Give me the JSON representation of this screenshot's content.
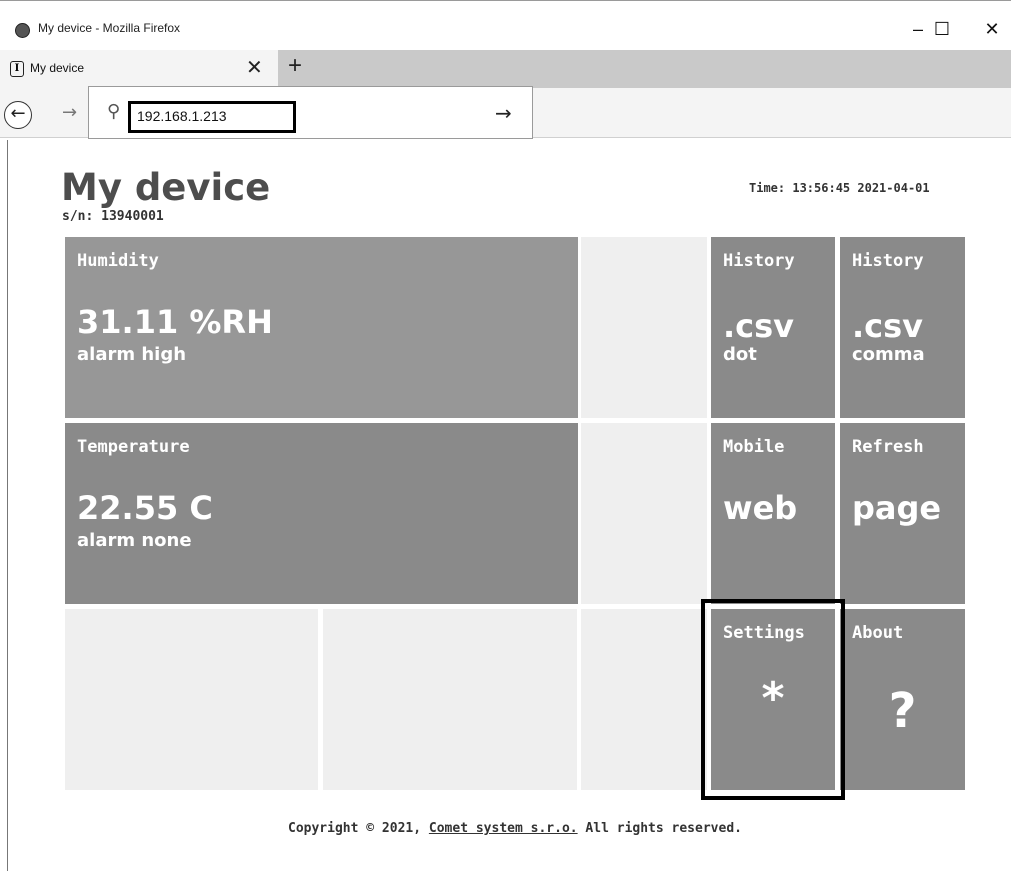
{
  "window": {
    "title": "My device - Mozilla Firefox",
    "minimize": "–",
    "maximize": "☐",
    "close": "✕"
  },
  "tab": {
    "icon_glyph": "I",
    "label": "My device",
    "close": "✕",
    "new_tab": "+"
  },
  "nav": {
    "back": "←",
    "forward": "→",
    "search_icon": "⚲",
    "url": "192.168.1.213",
    "go": "→"
  },
  "page": {
    "title": "My device",
    "serial": "s/n: 13940001",
    "time": "Time: 13:56:45 2021-04-01"
  },
  "tiles": {
    "humidity": {
      "label": "Humidity",
      "value": "31.11 %RH",
      "status": "alarm high"
    },
    "temperature": {
      "label": "Temperature",
      "value": "22.55 C",
      "status": "alarm none"
    },
    "history_dot": {
      "label": "History",
      "big": ".csv",
      "sub": "dot"
    },
    "history_comma": {
      "label": "History",
      "big": ".csv",
      "sub": "comma"
    },
    "mobile": {
      "label": "Mobile",
      "big": "web"
    },
    "refresh": {
      "label": "Refresh",
      "big": "page"
    },
    "settings": {
      "label": "Settings",
      "big": "*"
    },
    "about": {
      "label": "About",
      "big": "?"
    }
  },
  "footer": {
    "prefix": "Copyright © 2021, ",
    "link": "Comet system s.r.o.",
    "suffix": " All rights reserved."
  },
  "colors": {
    "tile_dark": "#8a8a8a",
    "tile_humidity": "#979797",
    "tile_empty": "#efefef",
    "title_text": "#4d4d4d"
  }
}
